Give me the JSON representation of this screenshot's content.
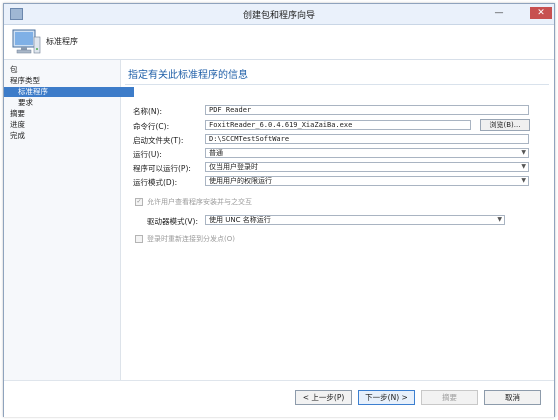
{
  "window": {
    "title": "创建包和程序向导",
    "controls": {
      "minimize": "—",
      "close": "✕"
    }
  },
  "header": {
    "icon": "computer-icon",
    "step_title": "标准程序"
  },
  "sidebar": {
    "items": [
      {
        "label": "包",
        "active": false,
        "indent": 0
      },
      {
        "label": "程序类型",
        "active": false,
        "indent": 0
      },
      {
        "label": "标准程序",
        "active": true,
        "indent": 1
      },
      {
        "label": "要求",
        "active": false,
        "indent": 1
      },
      {
        "label": "摘要",
        "active": false,
        "indent": 0
      },
      {
        "label": "进度",
        "active": false,
        "indent": 0
      },
      {
        "label": "完成",
        "active": false,
        "indent": 0
      }
    ]
  },
  "main": {
    "title": "指定有关此标准程序的信息",
    "fields": {
      "name": {
        "label": "名称(N):",
        "value": "PDF Reader"
      },
      "command_line": {
        "label": "命令行(C):",
        "value": "FoxitReader_6.0.4.619_XiaZaiBa.exe"
      },
      "browse_label": "浏览(B)...",
      "startup_folder": {
        "label": "启动文件夹(T):",
        "value": "D:\\SCCMTestSoftWare"
      },
      "run": {
        "label": "运行(U):",
        "value": "普通"
      },
      "program_can_run": {
        "label": "程序可以运行(P):",
        "value": "仅当用户登录时"
      },
      "run_mode": {
        "label": "运行模式(D):",
        "value": "使用用户的权限运行"
      },
      "allow_interact": {
        "label": "允许用户查看程序安装并与之交互",
        "checked": true,
        "disabled": true
      },
      "drive_mode": {
        "label": "驱动器模式(V):",
        "value": "使用 UNC 名称运行"
      },
      "reconnect": {
        "label": "登录时重新连接到分发点(O)",
        "checked": false,
        "disabled": true
      }
    }
  },
  "footer": {
    "prev": "< 上一步(P)",
    "next": "下一步(N) >",
    "summary": "摘要",
    "cancel": "取消"
  },
  "colors": {
    "accent": "#3d7cc9",
    "title_blue": "#1f5fa8"
  }
}
